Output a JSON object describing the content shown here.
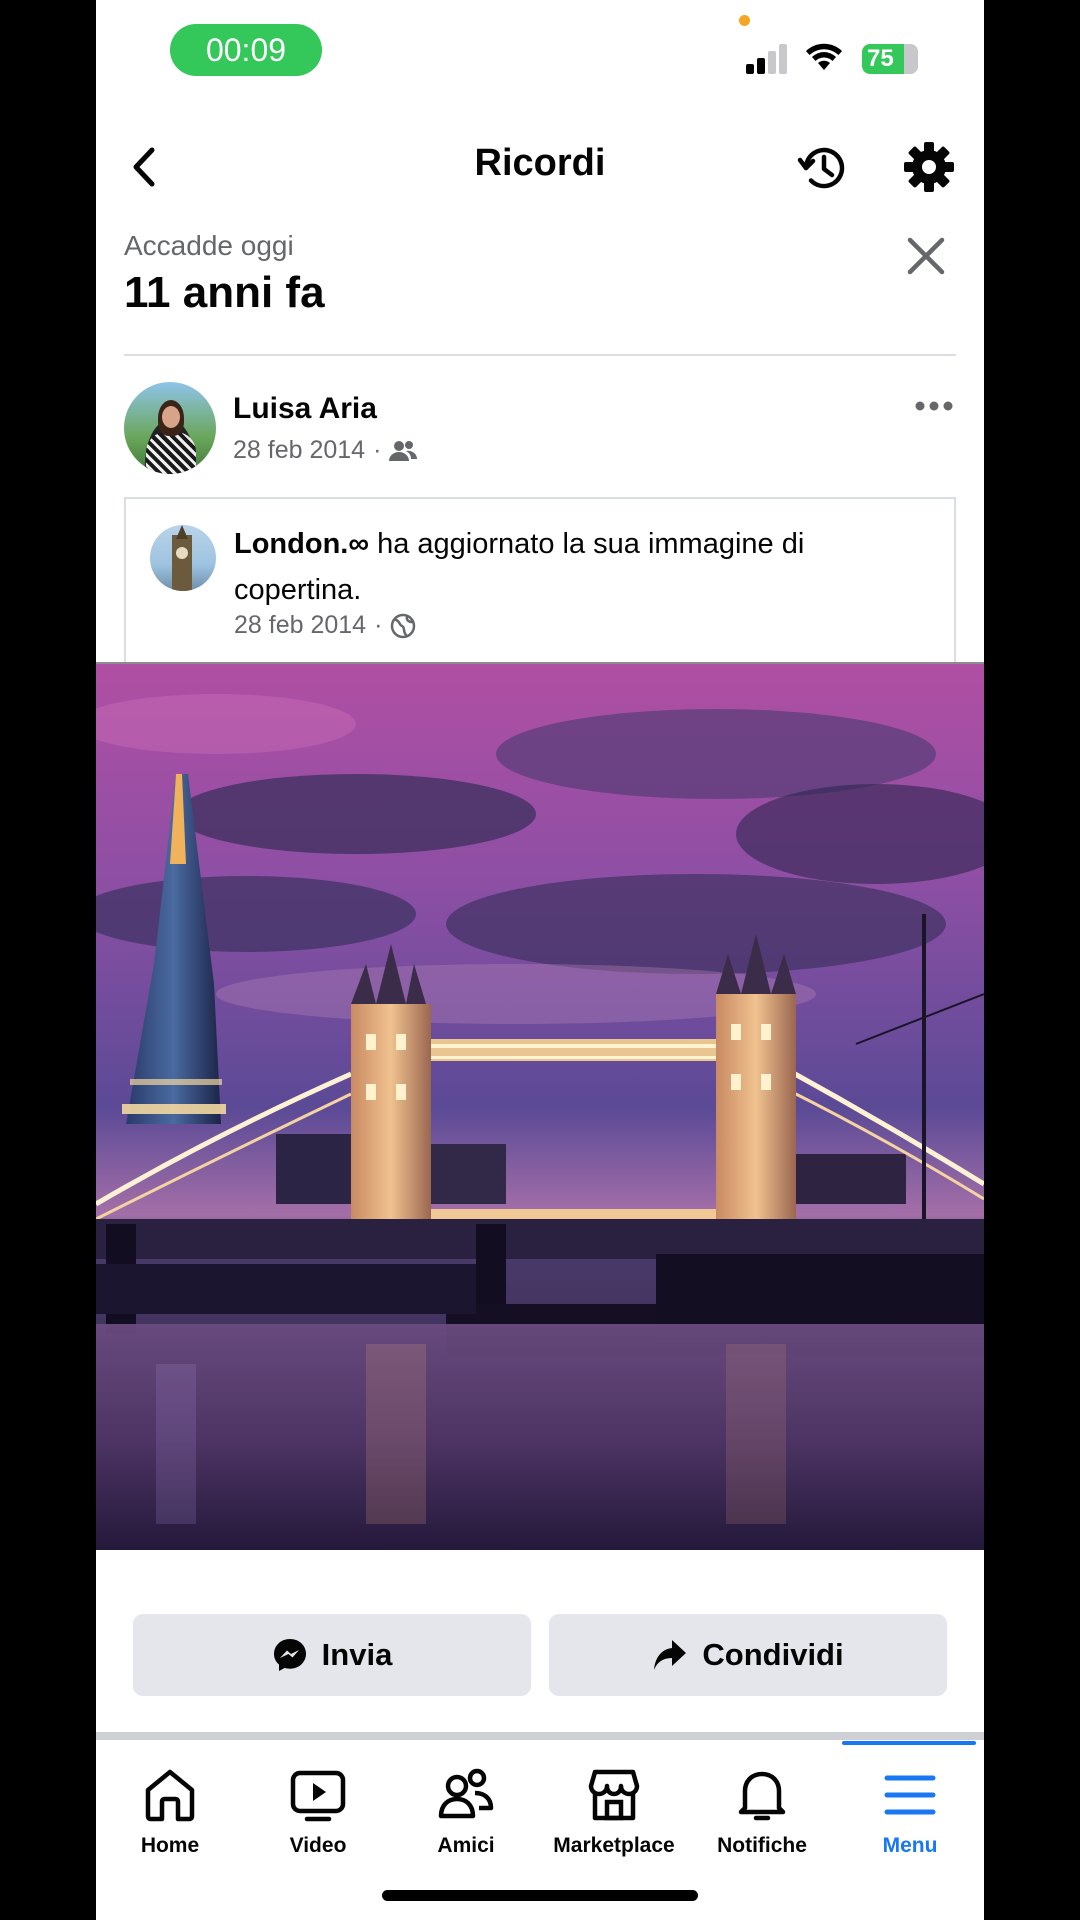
{
  "status_bar": {
    "timer": "00:09",
    "battery": "75"
  },
  "header": {
    "title": "Ricordi"
  },
  "memory": {
    "subtitle": "Accadde oggi",
    "title": "11 anni fa"
  },
  "post": {
    "author": "Luisa Aria",
    "date": "28 feb 2014",
    "separator": "·",
    "audience_icon": "friends-icon"
  },
  "shared": {
    "page_name": "London.∞",
    "action_text": " ha aggiornato la sua immagine di copertina.",
    "date": "28 feb 2014",
    "separator": "·",
    "audience_icon": "globe-icon"
  },
  "actions": {
    "send_label": "Invia",
    "share_label": "Condividi"
  },
  "nav": {
    "items": [
      {
        "label": "Home",
        "icon": "home-icon"
      },
      {
        "label": "Video",
        "icon": "video-icon"
      },
      {
        "label": "Amici",
        "icon": "friends-icon"
      },
      {
        "label": "Marketplace",
        "icon": "marketplace-icon"
      },
      {
        "label": "Notifiche",
        "icon": "bell-icon"
      },
      {
        "label": "Menu",
        "icon": "menu-icon"
      }
    ],
    "active": "Menu"
  },
  "colors": {
    "accent": "#1877f2",
    "timer_pill": "#34c759",
    "button_bg": "#e4e6eb",
    "secondary_text": "#65676b"
  }
}
